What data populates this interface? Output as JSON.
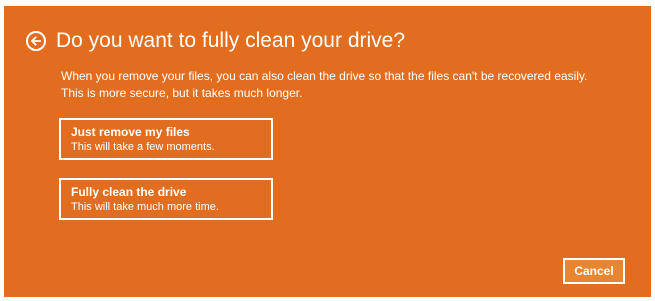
{
  "dialog": {
    "title": "Do you want to fully clean your drive?",
    "description_lines": [
      "When you remove your files, you can also clean the drive so that the files can't be recovered easily.",
      "This is more secure, but it takes much longer."
    ],
    "options": [
      {
        "title": "Just remove my files",
        "subtitle": "This will take a few moments."
      },
      {
        "title": "Fully clean the drive",
        "subtitle": "This will take much more time."
      }
    ],
    "cancel_label": "Cancel",
    "back_icon": "back-arrow-icon"
  },
  "colors": {
    "background": "#e36d1f",
    "text": "#ffffff",
    "cancel_background": "#e9852f"
  }
}
